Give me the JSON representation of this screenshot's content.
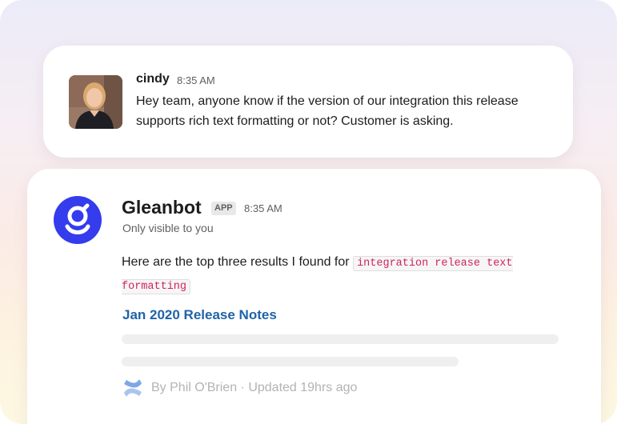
{
  "user_message": {
    "author": "cindy",
    "time": "8:35 AM",
    "text": "Hey team, anyone know if the version of our integration this release supports rich text formatting or not? Customer is asking."
  },
  "bot_message": {
    "name": "Gleanbot",
    "badge": "APP",
    "time": "8:35 AM",
    "visibility": "Only visible to you",
    "intro": "Here are the top three results I found for",
    "query": "integration release text formatting",
    "results": [
      {
        "title": "Jan 2020 Release Notes",
        "meta": "By Phil O'Brien · Updated 19hrs ago",
        "source_icon": "confluence-icon"
      }
    ]
  },
  "colors": {
    "brand": "#343ced",
    "link": "#1e64a8",
    "code_text": "#d0255b"
  }
}
